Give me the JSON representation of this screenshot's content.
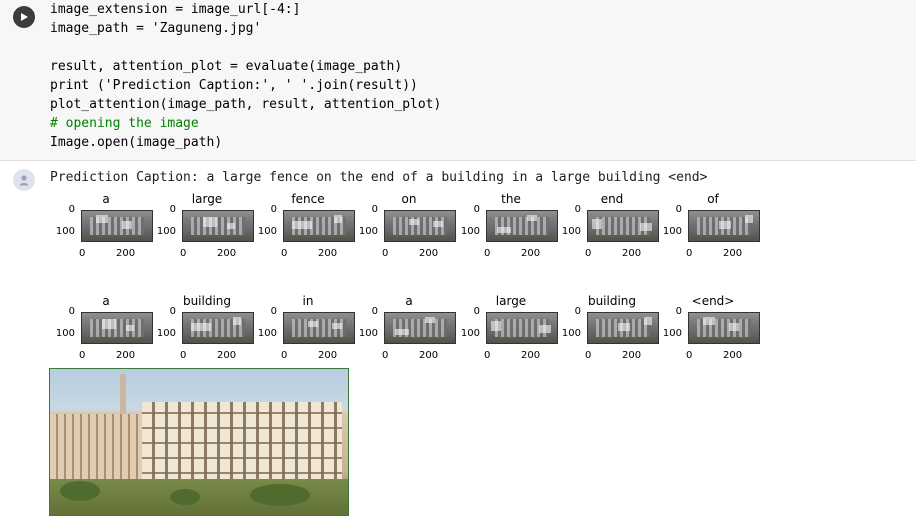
{
  "code_cell": {
    "lines": [
      "image_extension = image_url[-4:]",
      "image_path = 'Zaguneng.jpg'",
      "",
      "result, attention_plot = evaluate(image_path)",
      "print ('Prediction Caption:', ' '.join(result))",
      "plot_attention(image_path, result, attention_plot)",
      "# opening the image",
      "Image.open(image_path)"
    ],
    "run_icon": "play-icon"
  },
  "output": {
    "icon": "output-icon",
    "text": "Prediction Caption: a large fence on the end of a building in a large building <end>"
  },
  "attention_plots": {
    "ytick_0": "0",
    "ytick_100": "100",
    "xtick_0": "0",
    "xtick_200": "200",
    "row1": [
      "a",
      "large",
      "fence",
      "on",
      "the",
      "end",
      "of"
    ],
    "row2": [
      "a",
      "building",
      "in",
      "a",
      "large",
      "building",
      "<end>"
    ]
  },
  "image": {
    "name": "Zaguneng.jpg",
    "description_icon": "building-photo"
  }
}
